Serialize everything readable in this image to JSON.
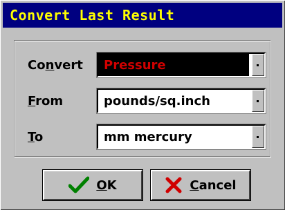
{
  "window": {
    "title": "Convert Last Result"
  },
  "fields": [
    {
      "label_pre": "Co",
      "label_ul": "n",
      "label_post": "vert",
      "value": "Pressure",
      "active": true
    },
    {
      "label_pre": "",
      "label_ul": "F",
      "label_post": "rom",
      "value": "pounds/sq.inch",
      "active": false
    },
    {
      "label_pre": "",
      "label_ul": "T",
      "label_post": "o",
      "value": "mm mercury",
      "active": false
    }
  ],
  "buttons": {
    "ok": {
      "label_ul": "O",
      "label_rest": "K",
      "icon": "checkmark-icon"
    },
    "cancel": {
      "label_ul": "C",
      "label_rest": "ancel",
      "icon": "x-icon"
    }
  },
  "colors": {
    "title_bg": "#000080",
    "title_fg": "#ffff00",
    "active_text": "#d00000",
    "ok_icon": "#008000",
    "cancel_icon": "#d00000"
  }
}
